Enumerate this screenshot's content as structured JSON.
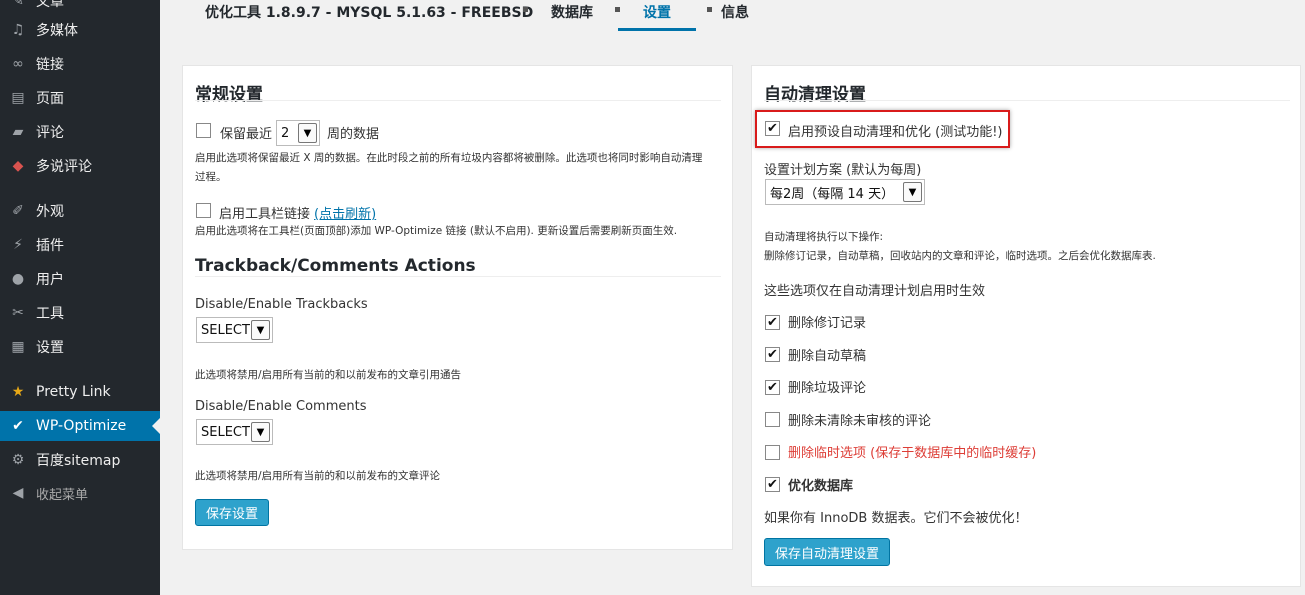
{
  "sidebar": {
    "items": [
      {
        "label": "文章",
        "icon": "pin-icon"
      },
      {
        "label": "多媒体",
        "icon": "media-icon"
      },
      {
        "label": "链接",
        "icon": "link-icon"
      },
      {
        "label": "页面",
        "icon": "page-icon"
      },
      {
        "label": "评论",
        "icon": "comment-icon"
      },
      {
        "label": "多说评论",
        "icon": "duoshuo-icon"
      },
      {
        "label": "外观",
        "icon": "brush-icon"
      },
      {
        "label": "插件",
        "icon": "plugin-icon"
      },
      {
        "label": "用户",
        "icon": "user-icon"
      },
      {
        "label": "工具",
        "icon": "wrench-icon"
      },
      {
        "label": "设置",
        "icon": "settings-icon"
      },
      {
        "label": "Pretty Link",
        "icon": "star-icon"
      },
      {
        "label": "WP-Optimize",
        "icon": "check-circle-icon"
      },
      {
        "label": "百度sitemap",
        "icon": "gear-icon"
      },
      {
        "label": "收起菜单",
        "icon": "collapse-icon"
      }
    ]
  },
  "tabs": {
    "title": "优化工具 1.8.9.7 - MYSQL 5.1.63 - FREEBSD",
    "database": "数据库",
    "settings": "设置",
    "info": "信息"
  },
  "general": {
    "title": "常规设置",
    "keep_prefix": "保留最近",
    "keep_value": "2",
    "keep_suffix": "周的数据",
    "keep_desc_1": "启用此选项将保留最近 X 周的数据。在此时段之前的所有垃圾内容都将被删除。此选项也将同时影响自动清理",
    "keep_desc_2": "过程。",
    "toolbar_label": "启用工具栏链接",
    "toolbar_link": "(点击刷新)",
    "toolbar_desc": "启用此选项将在工具栏(页面顶部)添加 WP-Optimize 链接 (默认不启用). 更新设置后需要刷新页面生效.",
    "trackback_title": "Trackback/Comments Actions",
    "trackbacks_label": "Disable/Enable Trackbacks",
    "trackbacks_value": "SELECT",
    "trackbacks_desc": "此选项将禁用/启用所有当前的和以前发布的文章引用通告",
    "comments_label": "Disable/Enable Comments",
    "comments_value": "SELECT",
    "comments_desc": "此选项将禁用/启用所有当前的和以前发布的文章评论",
    "save_button": "保存设置"
  },
  "auto": {
    "title": "自动清理设置",
    "enable_label": "启用预设自动清理和优化 (测试功能!)",
    "schedule_label": "设置计划方案 (默认为每周)",
    "schedule_value": "每2周（每隔 14 天）",
    "will_do_1": "自动清理将执行以下操作:",
    "will_do_2": "删除修订记录，自动草稿，回收站内的文章和评论，临时选项。之后会优化数据库表.",
    "only_when": "这些选项仅在自动清理计划启用时生效",
    "options": [
      {
        "label": "删除修订记录",
        "checked": true
      },
      {
        "label": "删除自动草稿",
        "checked": true
      },
      {
        "label": "删除垃圾评论",
        "checked": true
      },
      {
        "label": "删除未清除未审核的评论",
        "checked": false
      },
      {
        "label": "删除临时选项 (保存于数据库中的临时缓存)",
        "checked": false
      },
      {
        "label": "优化数据库",
        "checked": true
      }
    ],
    "innodb_note": "如果你有 InnoDB 数据表。它们不会被优化！",
    "save_button": "保存自动清理设置"
  },
  "colors": {
    "sidebar_bg": "#23282d",
    "active_bg": "#0073aa",
    "button_bg": "#2ea2cc",
    "warning_red": "#dd3d36",
    "highlight_border": "#d91b1b"
  }
}
